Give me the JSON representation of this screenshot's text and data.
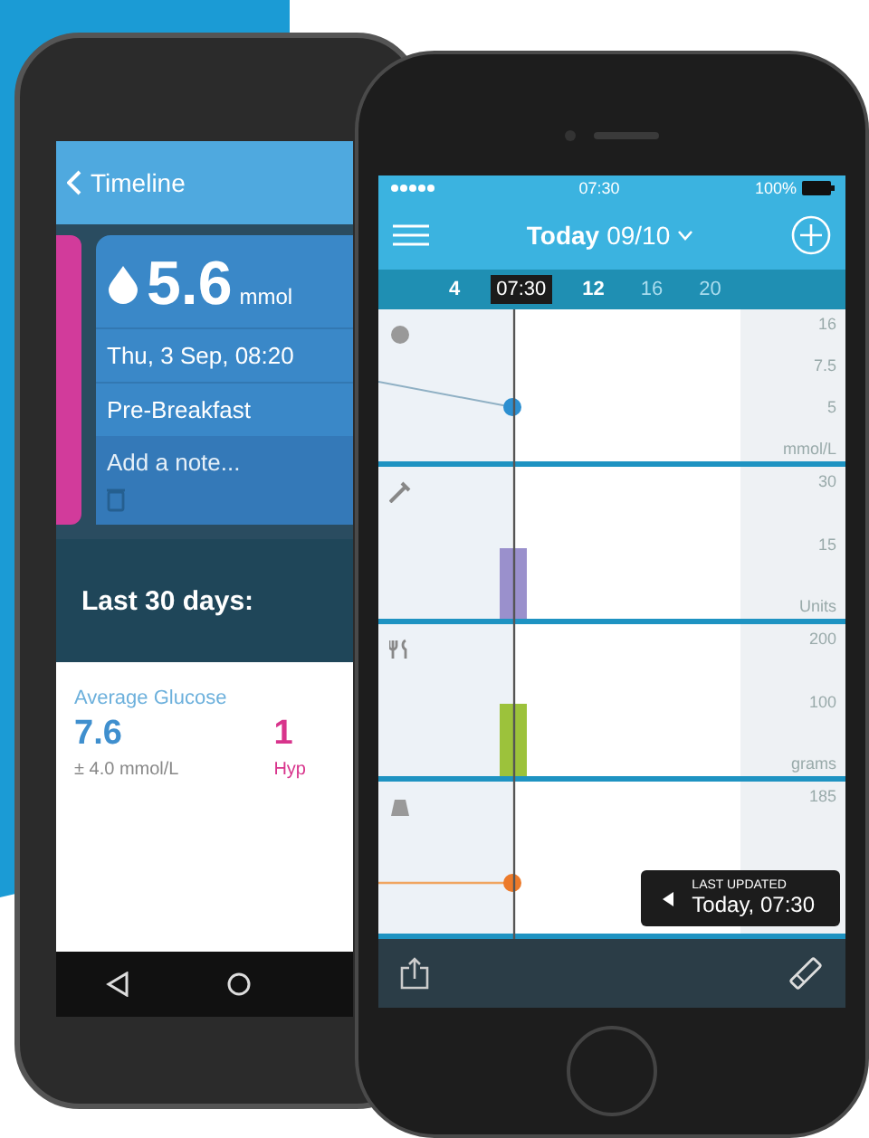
{
  "android_phone": {
    "header": {
      "title": "Timeline"
    },
    "reading_card": {
      "value": "5.6",
      "unit": "mmol",
      "datetime": "Thu, 3 Sep, 08:20",
      "meal": "Pre-Breakfast",
      "note_placeholder": "Add a note..."
    },
    "summary": {
      "heading": "Last 30 days:"
    },
    "stats": [
      {
        "kind": "glucose",
        "label": "Average Glucose",
        "value": "7.6",
        "detail": "± 4.0 mmol/L"
      },
      {
        "kind": "hypo",
        "value": "1",
        "detail": "Hyp"
      }
    ]
  },
  "iphone": {
    "status_bar": {
      "time": "07:30",
      "battery": "100%"
    },
    "header": {
      "title": "Today",
      "date": "09/10"
    },
    "time_axis": [
      {
        "label": "4",
        "selected": false,
        "dimmed": false
      },
      {
        "label": "07:30",
        "selected": true,
        "dimmed": false
      },
      {
        "label": "12",
        "selected": false,
        "dimmed": false
      },
      {
        "label": "16",
        "selected": false,
        "dimmed": true
      },
      {
        "label": "20",
        "selected": false,
        "dimmed": true
      }
    ],
    "panels": [
      {
        "kind": "glucose",
        "axis_labels": [
          "16",
          "7.5",
          "5",
          "mmol/L"
        ]
      },
      {
        "kind": "insulin",
        "axis_labels": [
          "30",
          "15",
          "Units"
        ]
      },
      {
        "kind": "carbs",
        "axis_labels": [
          "200",
          "100",
          "grams"
        ]
      },
      {
        "kind": "weight",
        "axis_labels": [
          "185"
        ]
      }
    ],
    "tooltip": {
      "caption": "LAST UPDATED",
      "time": "Today, 07:30"
    }
  }
}
